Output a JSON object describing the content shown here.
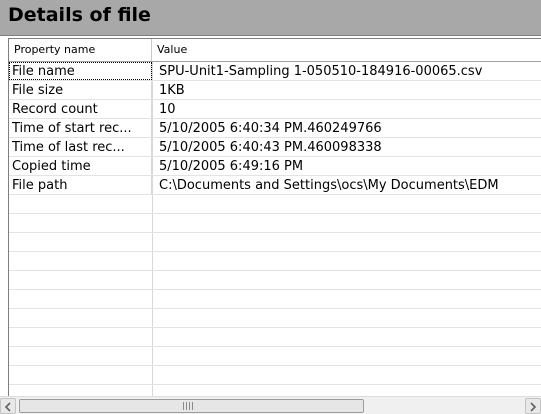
{
  "panel": {
    "title": "Details of file"
  },
  "table": {
    "columns": [
      "Property name",
      "Value"
    ],
    "rows": [
      {
        "property": "File name",
        "value": "SPU-Unit1-Sampling 1-050510-184916-00065.csv"
      },
      {
        "property": "File size",
        "value": "1KB"
      },
      {
        "property": "Record count",
        "value": "10"
      },
      {
        "property": "Time of start rec...",
        "value": "5/10/2005 6:40:34 PM.460249766"
      },
      {
        "property": "Time of last rec...",
        "value": "5/10/2005 6:40:43 PM.460098338"
      },
      {
        "property": "Copied time",
        "value": "5/10/2005 6:49:16 PM"
      },
      {
        "property": "File path",
        "value": "C:\\Documents and Settings\\ocs\\My Documents\\EDM"
      }
    ],
    "empty_row_count": 11
  },
  "scrollbar": {
    "left_icon": "chevron-left-icon",
    "right_icon": "chevron-right-icon",
    "grip_icon": "grip-icon"
  }
}
